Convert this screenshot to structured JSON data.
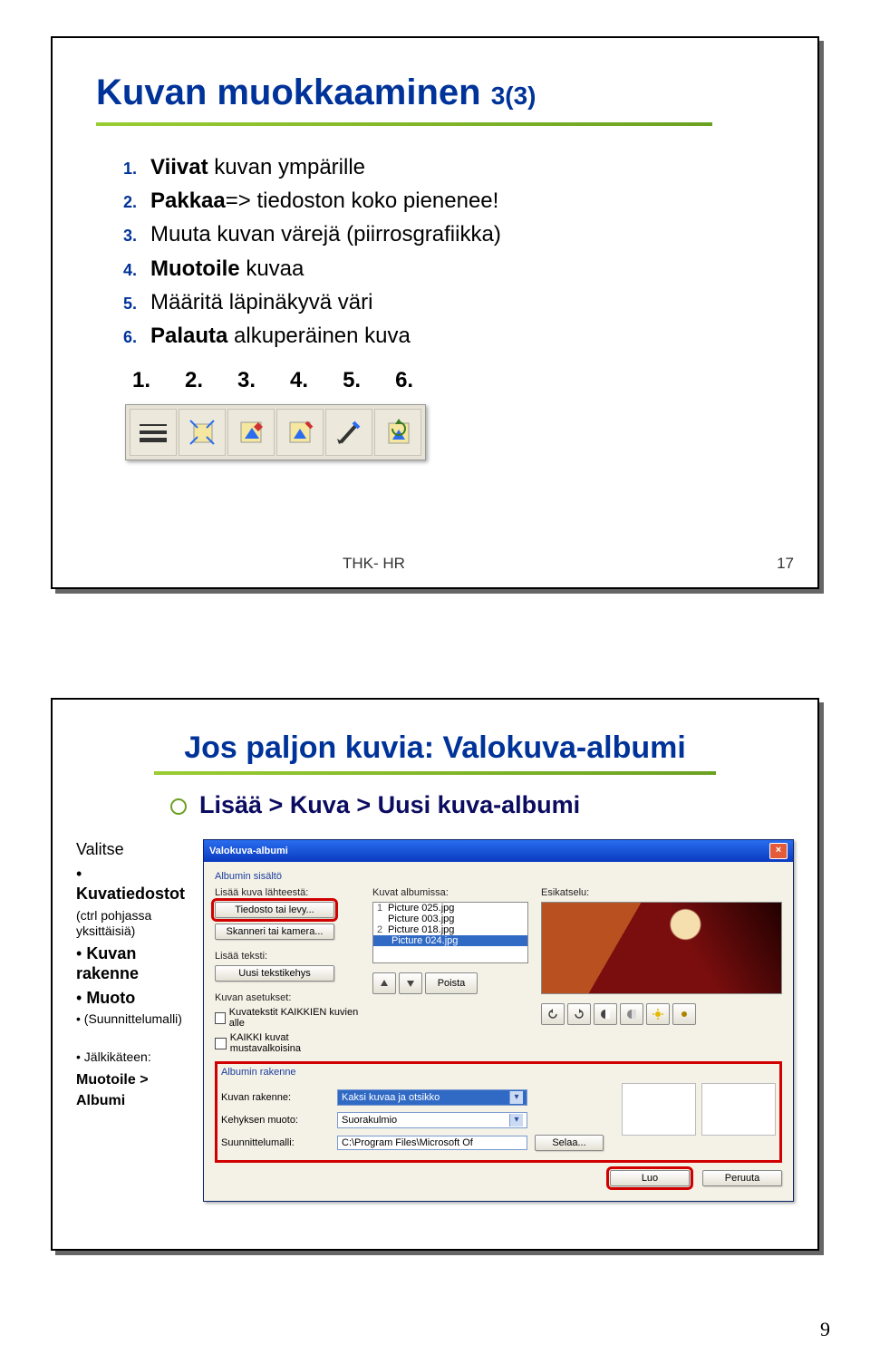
{
  "card1": {
    "title_main": "Kuvan muokkaaminen ",
    "title_small": "3(3)",
    "steps": [
      {
        "b": "Viivat",
        "rest": " kuvan ympärille"
      },
      {
        "b": "Pakkaa",
        "rest": "=> tiedoston koko pienenee!"
      },
      {
        "b": "",
        "rest": "Muuta kuvan värejä (piirrosgrafiikka)"
      },
      {
        "b": "Muotoile",
        "rest": " kuvaa"
      },
      {
        "b": "",
        "rest": "Määritä läpinäkyvä väri"
      },
      {
        "b": "Palauta",
        "rest": " alkuperäinen kuva"
      }
    ],
    "numbers": [
      "1.",
      "2.",
      "3.",
      "4.",
      "5.",
      "6."
    ],
    "footer_left": "THK- HR",
    "footer_right": "17"
  },
  "card2": {
    "heading": "Jos paljon kuvia: Valokuva-albumi",
    "subline": "Lisää > Kuva > Uusi kuva-albumi",
    "left": {
      "valitse": "Valitse",
      "b1": "Kuvatiedostot",
      "b1sub": "(ctrl pohjassa\nyksittäisiä)",
      "b2a": "Kuvan",
      "b2b": "rakenne",
      "b3": "Muoto",
      "b4": "(Suunnittelumalli)",
      "after_label": "Jälkikäteen:",
      "after_bold": "Muotoile > Albumi"
    },
    "dialog": {
      "title": "Valokuva-albumi",
      "group1": "Albumin sisältö",
      "lbl_add_from": "Lisää kuva lähteestä:",
      "btn_file": "Tiedosto tai levy...",
      "btn_scan": "Skanneri tai kamera...",
      "lbl_add_text": "Lisää teksti:",
      "btn_textbox": "Uusi tekstikehys",
      "lbl_settings": "Kuvan asetukset:",
      "chk1": "Kuvatekstit KAIKKIEN kuvien alle",
      "chk2": "KAIKKI kuvat mustavalkoisina",
      "lbl_inalbum": "Kuvat albumissa:",
      "list": [
        "Picture 025.jpg",
        "Picture 003.jpg",
        "Picture 018.jpg",
        "Picture 024.jpg"
      ],
      "lbl_preview": "Esikatselu:",
      "btn_remove": "Poista",
      "group2": "Albumin rakenne",
      "lbl_layout": "Kuvan rakenne:",
      "sel_layout": "Kaksi kuvaa ja otsikko",
      "lbl_frame": "Kehyksen muoto:",
      "sel_frame": "Suorakulmio",
      "lbl_template": "Suunnittelumalli:",
      "txt_template": "C:\\Program Files\\Microsoft Of",
      "btn_browse": "Selaa...",
      "btn_create": "Luo",
      "btn_cancel": "Peruuta"
    }
  },
  "page_number": "9"
}
